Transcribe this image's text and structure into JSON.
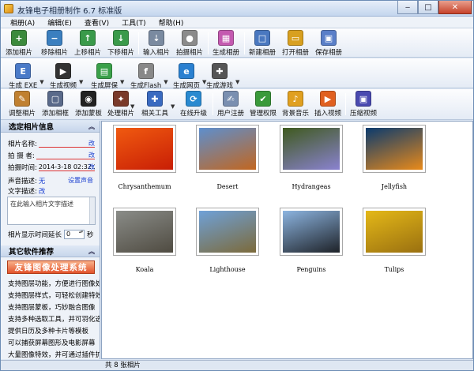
{
  "window": {
    "title": "友锋电子相册制作 6.7 标准版",
    "controls": {
      "minimize": "‒",
      "maximize": "□",
      "close": "✕"
    }
  },
  "menu": [
    "相册(A)",
    "编辑(E)",
    "查看(V)",
    "工具(T)",
    "帮助(H)"
  ],
  "toolbar1": [
    {
      "label": "添加相片",
      "icon": "add-photo-icon",
      "color": "#3c8a3c"
    },
    {
      "label": "移除相片",
      "icon": "remove-photo-icon",
      "color": "#3b7fbf"
    },
    {
      "label": "上移相片",
      "icon": "move-up-icon",
      "color": "#3a9a4a"
    },
    {
      "label": "下移相片",
      "icon": "move-down-icon",
      "color": "#3a9a4a"
    },
    {
      "label": "输入相片",
      "icon": "import-photo-icon",
      "color": "#7a8aa0"
    },
    {
      "label": "拍摄相片",
      "icon": "camera-icon",
      "color": "#8b8b8b"
    },
    {
      "label": "生成相册",
      "icon": "generate-album-icon",
      "color": "#c45ab0"
    },
    {
      "label": "新建相册",
      "icon": "new-album-icon",
      "color": "#4a78c0"
    },
    {
      "label": "打开相册",
      "icon": "open-album-icon",
      "color": "#d8a020"
    },
    {
      "label": "保存相册",
      "icon": "save-album-icon",
      "color": "#5a7fc8"
    }
  ],
  "toolbar2": [
    {
      "label": "生成 EXE",
      "icon": "exe-icon",
      "color": "#4a7ac8"
    },
    {
      "label": "生成视频",
      "icon": "video-icon",
      "color": "#333333"
    },
    {
      "label": "生成屏保",
      "icon": "screensaver-icon",
      "color": "#3aa04a"
    },
    {
      "label": "生成Flash",
      "icon": "flash-icon",
      "color": "#888888"
    },
    {
      "label": "生成网页",
      "icon": "webpage-icon",
      "color": "#2a80d0"
    },
    {
      "label": "生成游戏",
      "icon": "game-icon",
      "color": "#555555"
    }
  ],
  "toolbar3": [
    {
      "label": "调整相片",
      "icon": "adjust-photo-icon",
      "color": "#c08030"
    },
    {
      "label": "添加相框",
      "icon": "add-frame-icon",
      "color": "#5a6a8a"
    },
    {
      "label": "添加蒙板",
      "icon": "add-mask-icon",
      "color": "#222222"
    },
    {
      "label": "处理相片",
      "icon": "process-photo-icon",
      "color": "#7a3a2a"
    },
    {
      "label": "相关工具",
      "icon": "tools-icon",
      "color": "#3a6ac0"
    },
    {
      "label": "在线升级",
      "icon": "online-upgrade-icon",
      "color": "#2a8ad0"
    },
    {
      "label": "用户注册",
      "icon": "register-icon",
      "color": "#7a8fb0"
    },
    {
      "label": "管理权限",
      "icon": "permission-icon",
      "color": "#3a9a3a"
    },
    {
      "label": "背景音乐",
      "icon": "music-icon",
      "color": "#e0a020"
    },
    {
      "label": "插入视频",
      "icon": "insert-video-icon",
      "color": "#e06020"
    },
    {
      "label": "压缩视频",
      "icon": "compress-video-icon",
      "color": "#4a4ab0"
    }
  ],
  "left_panel": {
    "section1_title": "选定相片信息",
    "name_label": "相片名称:",
    "name_value": "",
    "photographer_label": "拍 摄 者:",
    "photographer_value": "",
    "time_label": "拍摄时间:",
    "time_value": "2014-3-18 02:32:22",
    "voice_label": "声音描述:",
    "voice_value": "无",
    "voice_setting": "设置声音",
    "text_label": "文字描述:",
    "edit_link": "改",
    "text_placeholder": "在此输入相片文字描述",
    "duration_label": "相片显示时间延长",
    "duration_value": "0",
    "duration_unit": "秒",
    "section2_title": "其它软件推荐",
    "banner": "友锋图像处理系统",
    "features": [
      "支持图层功能，方便进行图像处理",
      "支持图层样式，可轻松创建特效",
      "支持图层蒙板，巧妙融合图像",
      "支持多种选取工具，并可羽化选区",
      "提供日历及多种卡片等模板",
      "可以捕获屏幕图形及电影屏幕",
      "大量图像特效，并可通过插件扩充"
    ]
  },
  "photos": [
    {
      "name": "Chrysanthemum",
      "colors": [
        "#f05a10",
        "#c81e05"
      ]
    },
    {
      "name": "Desert",
      "colors": [
        "#5d8fce",
        "#c2661f"
      ]
    },
    {
      "name": "Hydrangeas",
      "colors": [
        "#3f5a1e",
        "#8a82d0"
      ]
    },
    {
      "name": "Jellyfish",
      "colors": [
        "#0a3a6e",
        "#e98a1a"
      ]
    },
    {
      "name": "Koala",
      "colors": [
        "#8a8c88",
        "#4f4b41"
      ]
    },
    {
      "name": "Lighthouse",
      "colors": [
        "#6fa1d8",
        "#7c6a3a"
      ]
    },
    {
      "name": "Penguins",
      "colors": [
        "#8cb4e0",
        "#1e2228"
      ]
    },
    {
      "name": "Tulips",
      "colors": [
        "#e4b818",
        "#9a7010"
      ]
    }
  ],
  "status": "共 8 张相片"
}
